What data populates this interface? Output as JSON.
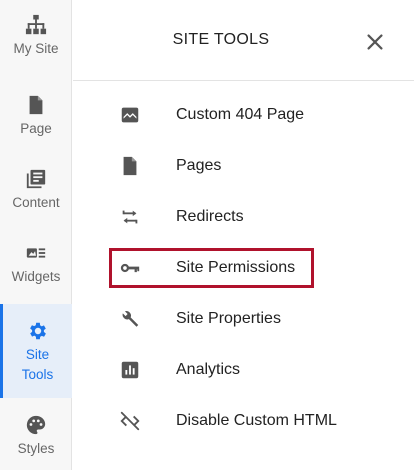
{
  "sidebar": {
    "items": [
      {
        "label": "My Site",
        "icon": "sitemap-icon"
      },
      {
        "label": "Page",
        "icon": "page-icon"
      },
      {
        "label": "Content",
        "icon": "content-library-icon"
      },
      {
        "label": "Widgets",
        "icon": "widgets-icon"
      },
      {
        "label": "Site\nTools",
        "label_line1": "Site",
        "label_line2": "Tools",
        "icon": "gear-icon",
        "active": true
      },
      {
        "label": "Styles",
        "icon": "palette-icon"
      }
    ]
  },
  "panel": {
    "title": "SITE TOOLS",
    "close_icon": "close-icon",
    "items": [
      {
        "label": "Custom 404 Page",
        "icon": "image-placeholder-icon"
      },
      {
        "label": "Pages",
        "icon": "page-icon"
      },
      {
        "label": "Redirects",
        "icon": "redirect-arrows-icon"
      },
      {
        "label": "Site Permissions",
        "icon": "key-icon",
        "highlighted": true
      },
      {
        "label": "Site Properties",
        "icon": "wrench-icon"
      },
      {
        "label": "Analytics",
        "icon": "bar-chart-icon"
      },
      {
        "label": "Disable Custom HTML",
        "icon": "code-off-icon"
      }
    ]
  },
  "colors": {
    "accent": "#1a73e8",
    "active_bg": "#e6eef9",
    "highlight_border": "#b0122c",
    "icon_gray": "#555555",
    "sidebar_bg": "#f7f7f7"
  }
}
